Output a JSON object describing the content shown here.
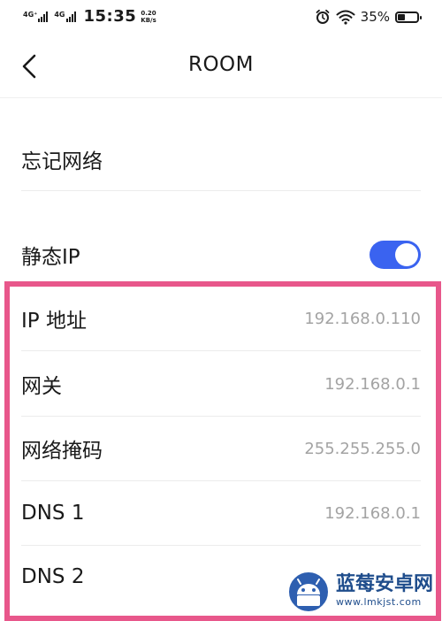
{
  "status_bar": {
    "network_1": "4G⁺",
    "network_2": "4G",
    "time": "15:35",
    "speed_value": "0.20",
    "speed_unit": "KB/s",
    "battery_percent": "35%",
    "battery_level": 0.35
  },
  "header": {
    "title": "ROOM"
  },
  "settings": {
    "forget_network_label": "忘记网络",
    "static_ip_label": "静态IP",
    "static_ip_enabled": true,
    "ip_address_label": "IP 地址",
    "ip_address_value": "192.168.0.110",
    "gateway_label": "网关",
    "gateway_value": "192.168.0.1",
    "netmask_label": "网络掩码",
    "netmask_value": "255.255.255.0",
    "dns1_label": "DNS 1",
    "dns1_value": "192.168.0.1",
    "dns2_label": "DNS 2"
  },
  "colors": {
    "toggle_on": "#3a63f0",
    "highlight_border": "#e8578b",
    "value_text": "#a3a3a3"
  },
  "watermark": {
    "name": "蓝莓安卓网",
    "url": "www.lmkjst.com"
  }
}
